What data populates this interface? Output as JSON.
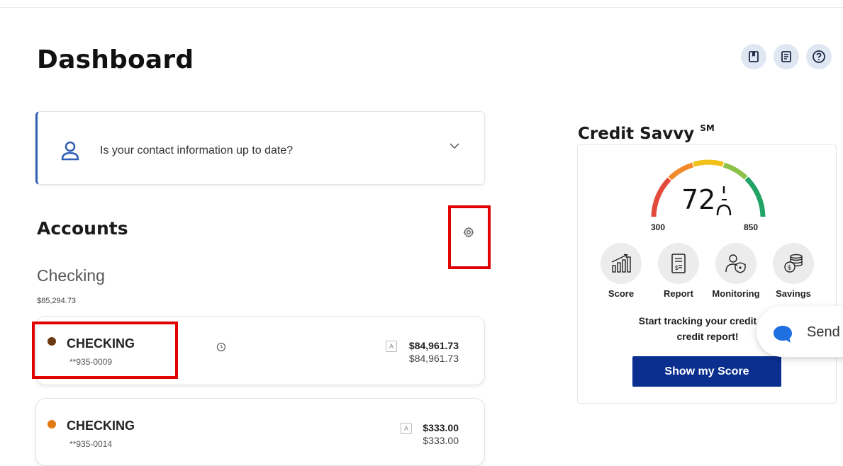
{
  "page": {
    "title": "Dashboard"
  },
  "header_icons": [
    "bookmark-icon",
    "document-icon",
    "help-icon"
  ],
  "contact_prompt": {
    "message": "Is your contact information up to date?"
  },
  "accounts": {
    "title": "Accounts",
    "group": {
      "label": "Checking",
      "total": "$85,294.73"
    },
    "items": [
      {
        "name": "CHECKING",
        "number": "**935-0009",
        "amount_available": "$84,961.73",
        "amount_current": "$84,961.73",
        "dot_color": "#6b3a12",
        "badge": "A"
      },
      {
        "name": "CHECKING",
        "number": "**935-0014",
        "amount_available": "$333.00",
        "amount_current": "$333.00",
        "dot_color": "#e07b13",
        "badge": "A"
      }
    ]
  },
  "credit_savvy": {
    "title": "Credit Savvy",
    "mark": "SM",
    "score": "72",
    "gauge_min": "300",
    "gauge_max": "850",
    "features": [
      {
        "label": "Score",
        "icon": "score-chart-icon"
      },
      {
        "label": "Report",
        "icon": "report-icon"
      },
      {
        "label": "Monitoring",
        "icon": "monitoring-icon"
      },
      {
        "label": "Savings",
        "icon": "savings-icon"
      }
    ],
    "promo_line1": "Start tracking your credit sco",
    "promo_line2": "credit report!",
    "button_label": "Show my Score"
  },
  "send_widget": {
    "label": "Send"
  },
  "colors": {
    "accent": "#0a2f8f",
    "contact_border": "#2f5eb3",
    "highlight": "#e00000"
  }
}
